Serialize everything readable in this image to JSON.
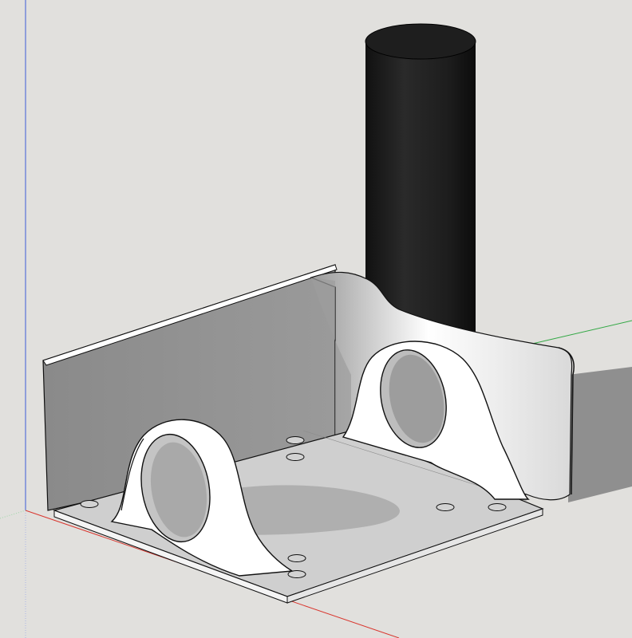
{
  "viewport": {
    "background": "#e1e0dd",
    "axes": {
      "x_axis_color": "#d9362e",
      "y_axis_color": "#33a845",
      "z_axis_color": "#3b5bd6"
    }
  },
  "model": {
    "bracket_color": "#ffffff",
    "edge_color": "#111111",
    "shadow_color": "#8e8e8e",
    "cylinder_color": "#1c1c1c",
    "mounting_holes": 8,
    "loop_openings": 2
  }
}
